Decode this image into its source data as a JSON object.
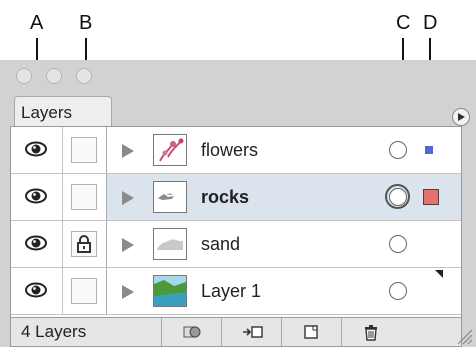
{
  "callouts": [
    "A",
    "B",
    "C",
    "D"
  ],
  "panel": {
    "tab_label": "Layers"
  },
  "layers": [
    {
      "name": "flowers",
      "selected": false,
      "locked": false,
      "targeted": false,
      "color": "#5566cc"
    },
    {
      "name": "rocks",
      "selected": true,
      "locked": false,
      "targeted": true,
      "color": "#e87070"
    },
    {
      "name": "sand",
      "selected": false,
      "locked": true,
      "targeted": false,
      "color": null
    },
    {
      "name": "Layer 1",
      "selected": false,
      "locked": false,
      "targeted": false,
      "color": null
    }
  ],
  "status": {
    "layer_count": "4 Layers"
  },
  "icons": {
    "visibility": "eye-icon",
    "lock": "lock-icon",
    "expand": "disclosure-triangle-icon",
    "target": "target-circle-icon",
    "selection": "selection-square-icon",
    "buttons": [
      "make-clipping-mask-icon",
      "create-sublayer-icon",
      "create-layer-icon",
      "trash-icon"
    ]
  },
  "colors": {
    "selected_row": "#dbe3ec",
    "selection_blue": "#5566cc",
    "selection_red": "#e87070"
  }
}
